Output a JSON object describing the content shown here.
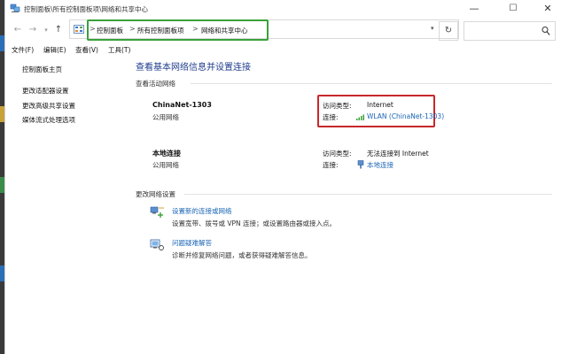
{
  "window": {
    "title": "控制面板\\所有控制面板项\\网络和共享中心",
    "minimize": "—",
    "maximize": "☐",
    "close": "✕"
  },
  "address_bar": {
    "crumbs": [
      "控制面板",
      "所有控制面板项",
      "网络和共享中心"
    ],
    "separator": ">",
    "highlight_color": "#39a13a"
  },
  "menu": {
    "items": [
      "文件(F)",
      "编辑(E)",
      "查看(V)",
      "工具(T)"
    ]
  },
  "left_nav": {
    "home": "控制面板主页",
    "links": [
      "更改适配器设置",
      "更改高级共享设置",
      "媒体流式处理选项"
    ]
  },
  "main": {
    "heading": "查看基本网络信息并设置连接",
    "active_networks_label": "查看活动网络",
    "networks": [
      {
        "name": "ChinaNet-1303",
        "type": "公用网络",
        "access_label": "访问类型:",
        "access_value": "Internet",
        "conn_label": "连接:",
        "conn_value": "WLAN (ChinaNet-1303)",
        "conn_icon": "wifi-signal-icon"
      },
      {
        "name": "本地连接",
        "type": "公用网络",
        "access_label": "访问类型:",
        "access_value": "无法连接到 Internet",
        "conn_label": "连接:",
        "conn_value": "本地连接",
        "conn_icon": "ethernet-icon"
      }
    ],
    "change_settings_label": "更改网络设置",
    "tasks": [
      {
        "link": "设置新的连接或网络",
        "desc": "设置宽带、拨号或 VPN 连接；或设置路由器或接入点。",
        "icon": "new-connection-icon"
      },
      {
        "link": "问题疑难解答",
        "desc": "诊断并修复网络问题，或者获得疑难解答信息。",
        "icon": "troubleshoot-icon"
      }
    ],
    "highlight_color": "#c8282a",
    "link_color": "#1a64b4",
    "heading_color": "#1e3d8c"
  }
}
